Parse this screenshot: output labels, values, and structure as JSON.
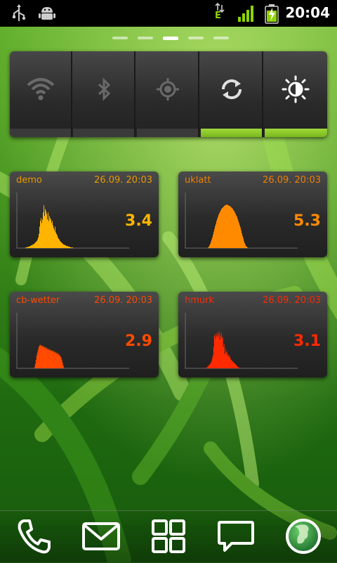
{
  "status_bar": {
    "time": "20:04",
    "network_type": "E",
    "icons": [
      "usb-icon",
      "android-debug-icon",
      "data-arrows-icon",
      "signal-icon",
      "battery-charging-icon"
    ]
  },
  "home": {
    "page_count": 5,
    "active_page": 2
  },
  "power_widget": {
    "toggles": [
      {
        "name": "wifi",
        "icon": "wifi-icon",
        "on": false
      },
      {
        "name": "bluetooth",
        "icon": "bluetooth-icon",
        "on": false
      },
      {
        "name": "gps",
        "icon": "gps-icon",
        "on": false
      },
      {
        "name": "sync",
        "icon": "sync-icon",
        "on": true
      },
      {
        "name": "brightness",
        "icon": "brightness-icon",
        "on": true
      }
    ]
  },
  "graph_widgets": [
    {
      "name": "demo",
      "timestamp": "26.09. 20:03",
      "value": "3.4",
      "color": "#ffb400",
      "label_color": "#e89a00",
      "profile": [
        0,
        0,
        0,
        0,
        0,
        0,
        0,
        0,
        0,
        0,
        0,
        1,
        1,
        1,
        2,
        2,
        2,
        3,
        3,
        4,
        4,
        5,
        5,
        6,
        7,
        8,
        9,
        10,
        12,
        15,
        20,
        30,
        38,
        42,
        35,
        40,
        50,
        60,
        45,
        55,
        52,
        48,
        40,
        50,
        38,
        45,
        42,
        40,
        35,
        38,
        32,
        28,
        25,
        30,
        22,
        20,
        18,
        15,
        13,
        12,
        10,
        9,
        8,
        7,
        6,
        5,
        5,
        4,
        4,
        3,
        3,
        3,
        2,
        2,
        2,
        1,
        1,
        1,
        1,
        0,
        0,
        0,
        0,
        0,
        0,
        0,
        0,
        0,
        0,
        0,
        0,
        0,
        0,
        0,
        0,
        0,
        0,
        0,
        0,
        0,
        0,
        0,
        0,
        0,
        0,
        0,
        0,
        0,
        0,
        0,
        0,
        0,
        0,
        0,
        0,
        0,
        0,
        0,
        0,
        0,
        0,
        0,
        0,
        0,
        0,
        0,
        0,
        0,
        0,
        0,
        0,
        0,
        0,
        0,
        0,
        0,
        0,
        0,
        0,
        0,
        0,
        0,
        0,
        0,
        0,
        0,
        0,
        0,
        0,
        0,
        0,
        0,
        0,
        0,
        0,
        0,
        0,
        0,
        0,
        0
      ]
    },
    {
      "name": "uklatt",
      "timestamp": "26.09. 20:03",
      "value": "5.3",
      "color": "#ff8a00",
      "label_color": "#f08000",
      "profile": [
        0,
        0,
        0,
        0,
        0,
        0,
        0,
        0,
        0,
        0,
        0,
        0,
        0,
        0,
        0,
        0,
        0,
        0,
        0,
        0,
        0,
        0,
        0,
        0,
        0,
        0,
        0,
        0,
        0,
        0,
        0,
        1,
        2,
        4,
        6,
        9,
        12,
        15,
        19,
        23,
        27,
        31,
        34,
        38,
        41,
        44,
        47,
        49,
        51,
        53,
        55,
        56,
        57,
        58,
        59,
        60,
        60,
        61,
        61,
        60,
        60,
        59,
        59,
        58,
        57,
        56,
        55,
        53,
        52,
        50,
        48,
        46,
        44,
        41,
        38,
        35,
        32,
        29,
        25,
        21,
        17,
        14,
        10,
        7,
        5,
        3,
        2,
        1,
        0,
        0,
        0,
        0,
        0,
        0,
        0,
        0,
        0,
        0,
        0,
        0,
        0,
        0,
        0,
        0,
        0,
        0,
        0,
        0,
        0,
        0,
        0,
        0,
        0,
        0,
        0,
        0,
        0,
        0,
        0,
        0,
        0,
        0,
        0,
        0,
        0,
        0,
        0,
        0,
        0,
        0,
        0,
        0,
        0,
        0,
        0,
        0,
        0,
        0,
        0,
        0,
        0,
        0,
        0,
        0,
        0,
        0,
        0,
        0,
        0,
        0,
        0,
        0,
        0,
        0,
        0,
        0,
        0,
        0,
        0,
        0
      ]
    },
    {
      "name": "cb-wetter",
      "timestamp": "26.09. 20:03",
      "value": "2.9",
      "color": "#ff4a00",
      "label_color": "#ff4a00",
      "profile": [
        0,
        0,
        0,
        0,
        0,
        0,
        0,
        0,
        0,
        0,
        0,
        0,
        0,
        0,
        0,
        0,
        0,
        0,
        0,
        0,
        0,
        0,
        0,
        0,
        2,
        6,
        12,
        18,
        22,
        26,
        30,
        32,
        33,
        32,
        31,
        32,
        30,
        31,
        29,
        30,
        28,
        29,
        27,
        28,
        26,
        27,
        25,
        26,
        25,
        24,
        25,
        23,
        24,
        22,
        23,
        21,
        22,
        20,
        21,
        19,
        18,
        17,
        15,
        12,
        8,
        4,
        1,
        0,
        0,
        0,
        0,
        0,
        0,
        0,
        0,
        0,
        0,
        0,
        0,
        0,
        0,
        0,
        0,
        0,
        0,
        0,
        0,
        0,
        0,
        0,
        0,
        0,
        0,
        0,
        0,
        0,
        0,
        0,
        0,
        0,
        0,
        0,
        0,
        0,
        0,
        0,
        0,
        0,
        0,
        0,
        0,
        0,
        0,
        0,
        0,
        0,
        0,
        0,
        0,
        0,
        0,
        0,
        0,
        0,
        0,
        0,
        0,
        0,
        0,
        0,
        0,
        0,
        0,
        0,
        0,
        0,
        0,
        0,
        0,
        0,
        0,
        0,
        0,
        0,
        0,
        0,
        0,
        0,
        0,
        0,
        0,
        0,
        0,
        0,
        0,
        0,
        0,
        0,
        0,
        0,
        0
      ]
    },
    {
      "name": "hmurk",
      "timestamp": "26.09. 20:03",
      "value": "3.1",
      "color": "#ff2a00",
      "label_color": "#ff2a00",
      "profile": [
        0,
        0,
        0,
        0,
        0,
        0,
        0,
        0,
        0,
        0,
        0,
        0,
        0,
        0,
        0,
        0,
        0,
        0,
        0,
        0,
        0,
        0,
        0,
        0,
        0,
        0,
        0,
        0,
        0,
        1,
        2,
        3,
        4,
        5,
        6,
        8,
        10,
        14,
        18,
        30,
        45,
        48,
        42,
        46,
        50,
        44,
        48,
        52,
        40,
        46,
        50,
        42,
        44,
        30,
        34,
        20,
        28,
        22,
        24,
        18,
        20,
        16,
        18,
        14,
        12,
        11,
        10,
        9,
        8,
        7,
        6,
        5,
        4,
        3,
        2,
        1,
        1,
        0,
        0,
        0,
        0,
        0,
        0,
        0,
        0,
        0,
        0,
        0,
        0,
        0,
        0,
        0,
        0,
        0,
        0,
        0,
        0,
        0,
        0,
        0,
        0,
        0,
        0,
        0,
        0,
        0,
        0,
        0,
        0,
        0,
        0,
        0,
        0,
        0,
        0,
        0,
        0,
        0,
        0,
        0,
        0,
        0,
        0,
        0,
        0,
        0,
        0,
        0,
        0,
        0,
        0,
        0,
        0,
        0,
        0,
        0,
        0,
        0,
        0,
        0,
        0,
        0,
        0,
        0,
        0,
        0,
        0,
        0,
        0,
        0,
        0,
        0,
        0,
        0,
        0,
        0,
        0,
        0,
        0,
        0,
        0
      ]
    }
  ],
  "dock": {
    "items": [
      {
        "name": "phone",
        "icon": "phone-icon"
      },
      {
        "name": "email",
        "icon": "mail-icon"
      },
      {
        "name": "app-drawer",
        "icon": "app-grid-icon"
      },
      {
        "name": "messaging",
        "icon": "message-icon"
      },
      {
        "name": "browser",
        "icon": "globe-icon"
      }
    ]
  },
  "colors": {
    "accent_green": "#8ed400",
    "widget_bg": "#2a2a2a",
    "toggle_on": "#9fd838",
    "toggle_off": "#3a3a3a"
  }
}
